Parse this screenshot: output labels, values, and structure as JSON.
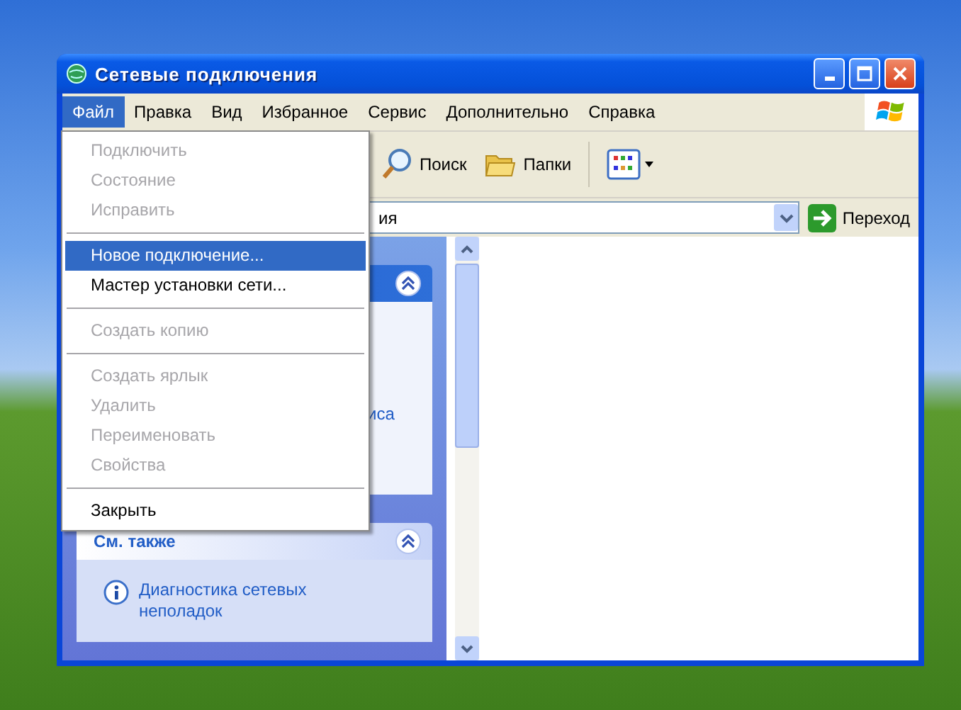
{
  "window": {
    "title": "Сетевые подключения"
  },
  "menu_bar": [
    {
      "label": "Файл",
      "selected": true
    },
    {
      "label": "Правка",
      "selected": false
    },
    {
      "label": "Вид",
      "selected": false
    },
    {
      "label": "Избранное",
      "selected": false
    },
    {
      "label": "Сервис",
      "selected": false
    },
    {
      "label": "Дополнительно",
      "selected": false
    },
    {
      "label": "Справка",
      "selected": false
    }
  ],
  "file_menu": [
    {
      "kind": "item",
      "label": "Подключить",
      "disabled": true,
      "selected": false
    },
    {
      "kind": "item",
      "label": "Состояние",
      "disabled": true,
      "selected": false
    },
    {
      "kind": "item",
      "label": "Исправить",
      "disabled": true,
      "selected": false
    },
    {
      "kind": "separator"
    },
    {
      "kind": "item",
      "label": "Новое подключение...",
      "disabled": false,
      "selected": true
    },
    {
      "kind": "item",
      "label": "Мастер установки сети...",
      "disabled": false,
      "selected": false
    },
    {
      "kind": "separator"
    },
    {
      "kind": "item",
      "label": "Создать копию",
      "disabled": true,
      "selected": false
    },
    {
      "kind": "separator"
    },
    {
      "kind": "item",
      "label": "Создать ярлык",
      "disabled": true,
      "selected": false
    },
    {
      "kind": "item",
      "label": "Удалить",
      "disabled": true,
      "selected": false
    },
    {
      "kind": "item",
      "label": "Переименовать",
      "disabled": true,
      "selected": false
    },
    {
      "kind": "item",
      "label": "Свойства",
      "disabled": true,
      "selected": false
    },
    {
      "kind": "separator"
    },
    {
      "kind": "item",
      "label": "Закрыть",
      "disabled": false,
      "selected": false
    }
  ],
  "toolbar": [
    {
      "kind": "search",
      "label": "Поиск"
    },
    {
      "kind": "folders",
      "label": "Папки"
    },
    {
      "kind": "views"
    }
  ],
  "address_bar": {
    "value": "ия",
    "go_button": "Переход"
  },
  "task_panel": {
    "sections": [
      {
        "text": "иса"
      },
      {
        "title": "См. также",
        "links": [
          "Диагностика сетевых неполадок"
        ]
      }
    ]
  }
}
